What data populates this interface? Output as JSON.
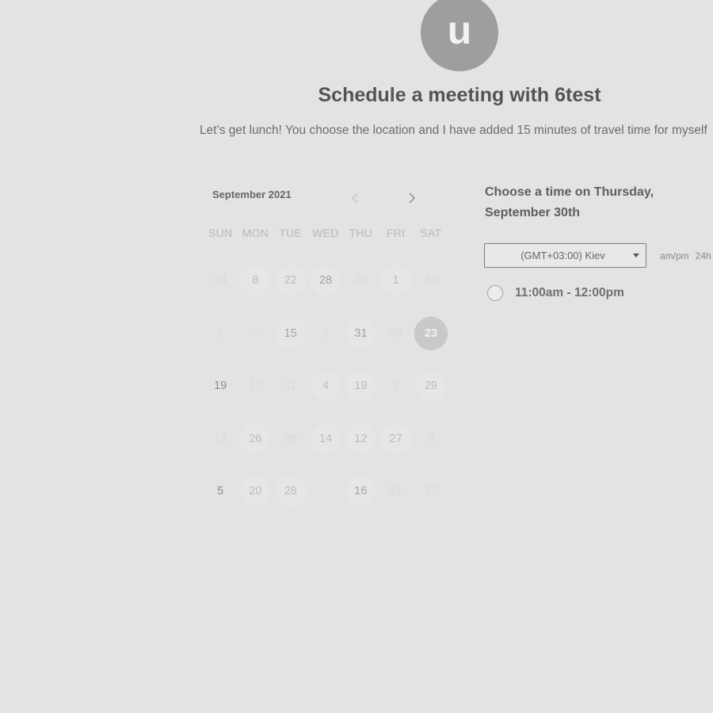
{
  "host": {
    "avatar_initial": "u"
  },
  "header": {
    "title": "Schedule a meeting with 6test",
    "description": "Let’s get lunch! You choose the location and I have added 15 minutes of travel time for myself"
  },
  "calendar": {
    "month_label": "September 2021",
    "weekdays": [
      "SUN",
      "MON",
      "TUE",
      "WED",
      "THU",
      "FRI",
      "SAT"
    ],
    "weeks": [
      [
        "24",
        "8",
        "22",
        "28",
        "29",
        "1",
        "24"
      ],
      [
        "5",
        "–",
        "15",
        "6",
        "31",
        "25",
        "23"
      ],
      [
        "19",
        "17",
        "11",
        "4",
        "19",
        "2",
        "29"
      ],
      [
        "13",
        "26",
        "29",
        "14",
        "12",
        "27",
        "3"
      ],
      [
        "5",
        "20",
        "28",
        "",
        "16",
        "21",
        "27"
      ]
    ],
    "selected_day": "23"
  },
  "time_panel": {
    "heading": "Choose a time on Thursday, September 30th",
    "timezone": "(GMT+03:00) Kiev",
    "format_ampm": "am/pm",
    "format_24h": "24h",
    "slots": [
      "11:00am - 12:00pm"
    ]
  },
  "colors": {
    "background": "#e3e3e3",
    "avatar": "#9e9e9e",
    "selected_day": "#c9c9c9"
  }
}
